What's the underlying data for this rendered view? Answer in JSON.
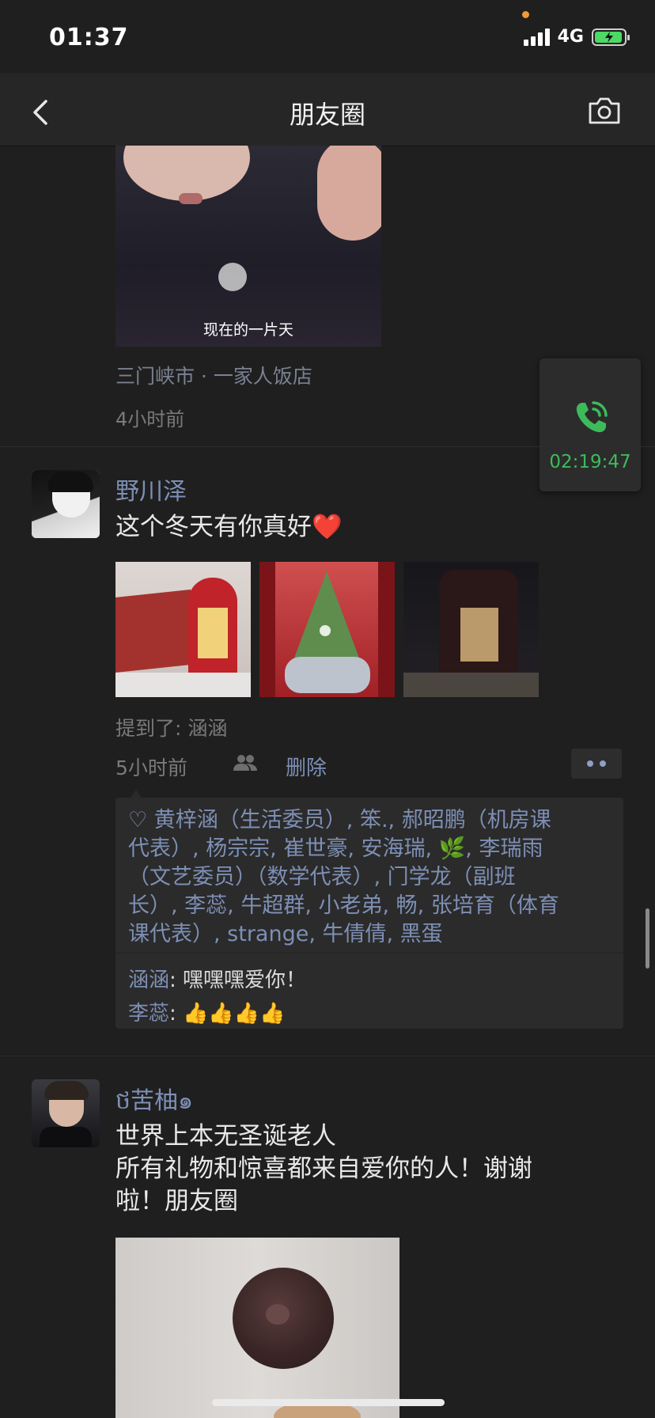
{
  "status_bar": {
    "time": "01:37",
    "network": "4G"
  },
  "nav": {
    "title": "朋友圈"
  },
  "post1": {
    "caption": "现在的一片天",
    "location": "三门峡市 · 一家人饭店",
    "time": "4小时前"
  },
  "floating_call": {
    "duration": "02:19:47"
  },
  "post2": {
    "author": "野川泽",
    "text": "这个冬天有你真好❤️",
    "mention": "提到了: 涵涵",
    "time": "5小时前",
    "delete_label": "删除",
    "likes_lines": [
      "♡ 黄梓涵（生活委员）, 笨., 郝昭鹏（机房课",
      "代表）, 杨宗宗, 崔世豪, 安海瑞, 🌿, 李瑞雨",
      "（文艺委员）（数学代表）, 门学龙（副班",
      "长）, 李蕊, 牛超群, 小老弟, 畅, 张培育（体育",
      "课代表）, strange, 牛倩倩, 黑蛋"
    ],
    "comments": [
      {
        "name": "涵涵",
        "text": ": 嘿嘿嘿爱你！"
      },
      {
        "name": "李蕊",
        "text": ": 👍👍👍👍"
      }
    ]
  },
  "post3": {
    "author": "ថ苦柚๑",
    "text_lines": [
      "世界上本无圣诞老人",
      "所有礼物和惊喜都来自爱你的人！谢谢",
      "啦！朋友圈"
    ]
  },
  "colors": {
    "link": "#7d8fb5",
    "call_green": "#3dbb5a",
    "background": "#1f1f1f"
  }
}
